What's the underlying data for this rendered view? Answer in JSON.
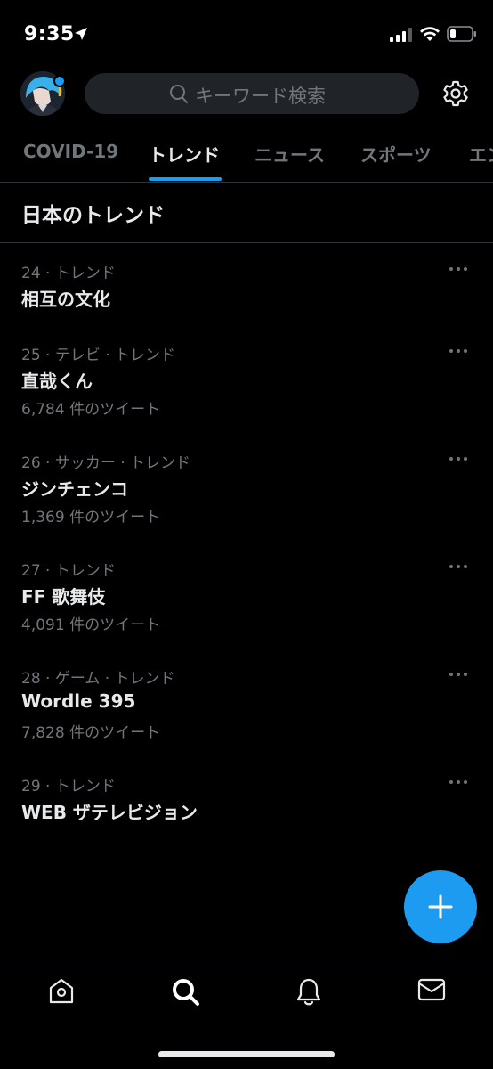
{
  "status_bar": {
    "time": "9:35",
    "icons": [
      "location-arrow-icon",
      "signal-icon",
      "wifi-icon",
      "battery-icon"
    ]
  },
  "header": {
    "search_placeholder": "キーワード検索",
    "icons": [
      "search-icon",
      "gear-icon"
    ]
  },
  "tabs": [
    {
      "label": "COVID-19",
      "active": false
    },
    {
      "label": "トレンド",
      "active": true
    },
    {
      "label": "ニュース",
      "active": false
    },
    {
      "label": "スポーツ",
      "active": false
    },
    {
      "label": "エン",
      "active": false
    }
  ],
  "section": {
    "title": "日本のトレンド"
  },
  "trends": [
    {
      "meta": "24 · トレンド",
      "name": "相互の文化",
      "count": ""
    },
    {
      "meta": "25 · テレビ · トレンド",
      "name": "直哉くん",
      "count": "6,784 件のツイート"
    },
    {
      "meta": "26 · サッカー · トレンド",
      "name": "ジンチェンコ",
      "count": "1,369 件のツイート"
    },
    {
      "meta": "27 · トレンド",
      "name": "FF 歌舞伎",
      "count": "4,091 件のツイート"
    },
    {
      "meta": "28 · ゲーム · トレンド",
      "name": "Wordle 395",
      "count": "7,828 件のツイート"
    },
    {
      "meta": "29 · トレンド",
      "name": "WEB ザテレビジョン",
      "count": ""
    }
  ],
  "bottom_nav": {
    "items": [
      "home-icon",
      "search-icon",
      "notifications-bell-icon",
      "messages-envelope-icon"
    ]
  },
  "colors": {
    "background": "#000000",
    "accent": "#1d9bf0",
    "primary_text": "#e7e9ea",
    "secondary_text": "#71767b",
    "search_bg": "#202327",
    "divider": "#2f3336"
  }
}
